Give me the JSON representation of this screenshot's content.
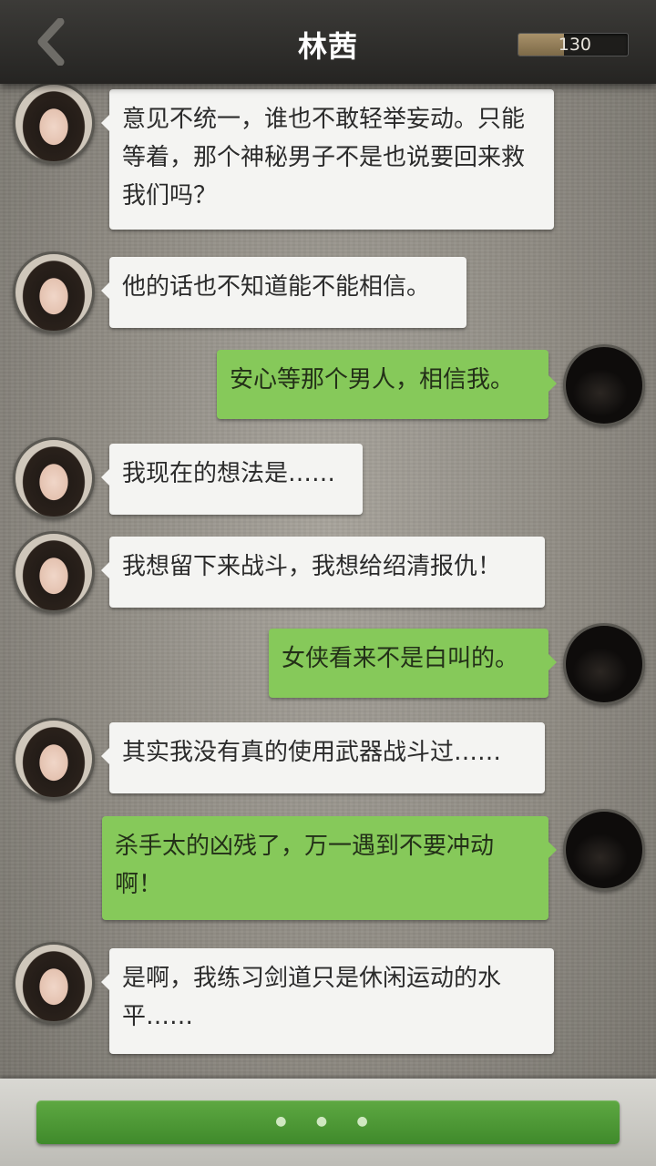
{
  "header": {
    "title": "林茜",
    "coins": "130",
    "coin_fill_fraction": 0.42
  },
  "messages": [
    {
      "side": "left",
      "speaker": "girl",
      "text": "意见不统一，谁也不敢轻举妄动。只能等着，那个神秘男子不是也说要回来救我们吗？"
    },
    {
      "side": "left",
      "speaker": "girl",
      "text": "他的话也不知道能不能相信。"
    },
    {
      "side": "right",
      "speaker": "player",
      "text": "安心等那个男人，相信我。"
    },
    {
      "side": "left",
      "speaker": "girl",
      "text": "我现在的想法是……"
    },
    {
      "side": "left",
      "speaker": "girl",
      "text": "我想留下来战斗，我想给绍清报仇！"
    },
    {
      "side": "right",
      "speaker": "player",
      "text": "女侠看来不是白叫的。"
    },
    {
      "side": "left",
      "speaker": "girl",
      "text": "其实我没有真的使用武器战斗过……"
    },
    {
      "side": "right",
      "speaker": "player",
      "text": "杀手太的凶残了，万一遇到不要冲动啊！"
    },
    {
      "side": "left",
      "speaker": "girl",
      "text": "是啊，我练习剑道只是休闲运动的水平……"
    }
  ],
  "footer": {
    "indicator": "● ● ●"
  }
}
